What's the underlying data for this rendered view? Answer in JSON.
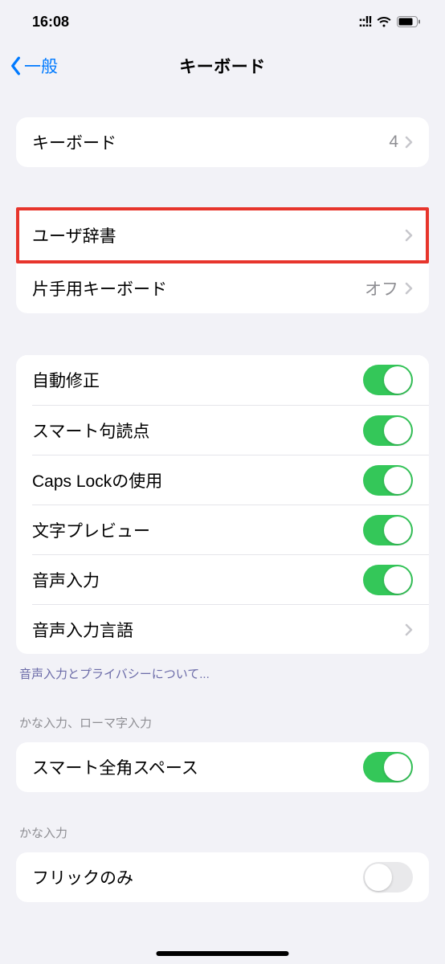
{
  "status": {
    "time": "16:08"
  },
  "nav": {
    "back": "一般",
    "title": "キーボード"
  },
  "group1": {
    "keyboards": {
      "label": "キーボード",
      "value": "4"
    }
  },
  "group2": {
    "user_dict": {
      "label": "ユーザ辞書"
    },
    "one_handed": {
      "label": "片手用キーボード",
      "value": "オフ"
    }
  },
  "group3": {
    "autocorrect": {
      "label": "自動修正"
    },
    "smart_punct": {
      "label": "スマート句読点"
    },
    "caps_lock": {
      "label": "Caps Lockの使用"
    },
    "char_preview": {
      "label": "文字プレビュー"
    },
    "dictation": {
      "label": "音声入力"
    },
    "dictation_lang": {
      "label": "音声入力言語"
    }
  },
  "footer1": "音声入力とプライバシーについて...",
  "header2": "かな入力、ローマ字入力",
  "group4": {
    "smart_fullwidth": {
      "label": "スマート全角スペース"
    }
  },
  "header3": "かな入力",
  "group5": {
    "flick_only": {
      "label": "フリックのみ"
    }
  }
}
